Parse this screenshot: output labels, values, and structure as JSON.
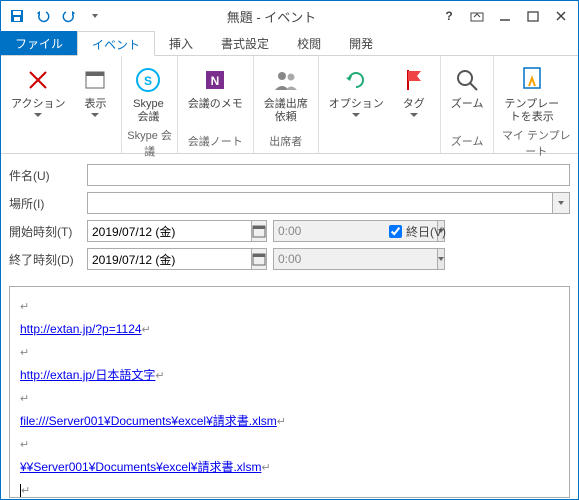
{
  "window": {
    "title": "無題 - イベント"
  },
  "tabs": {
    "file": "ファイル",
    "event": "イベント",
    "insert": "挿入",
    "format": "書式設定",
    "review": "校閲",
    "develop": "開発"
  },
  "ribbon": {
    "actions": "アクション",
    "show": "表示",
    "skype": "Skype\n会議",
    "skype_group": "Skype 会議",
    "meeting_notes": "会議のメモ",
    "notes_group": "会議ノート",
    "attendees": "会議出席\n依頼",
    "attendees_group": "出席者",
    "options": "オプション",
    "tags": "タグ",
    "zoom": "ズーム",
    "zoom_group": "ズーム",
    "template": "テンプレー\nトを表示",
    "template_group": "マイ テンプレート"
  },
  "form": {
    "subject_label": "件名(U)",
    "subject_value": "",
    "location_label": "場所(I)",
    "location_value": "",
    "start_label": "開始時刻(T)",
    "start_date": "2019/07/12 (金)",
    "start_time": "0:00",
    "end_label": "終了時刻(D)",
    "end_date": "2019/07/12 (金)",
    "end_time": "0:00",
    "allday_label": "終日(V)",
    "allday_checked": true
  },
  "body": {
    "link1": "http://extan.jp/?p=1124",
    "link2": "http://extan.jp/日本語文字",
    "link3": "file:///Server001¥Documents¥excel¥請求書.xlsm",
    "link4": "¥¥Server001¥Documents¥excel¥請求書.xlsm"
  }
}
